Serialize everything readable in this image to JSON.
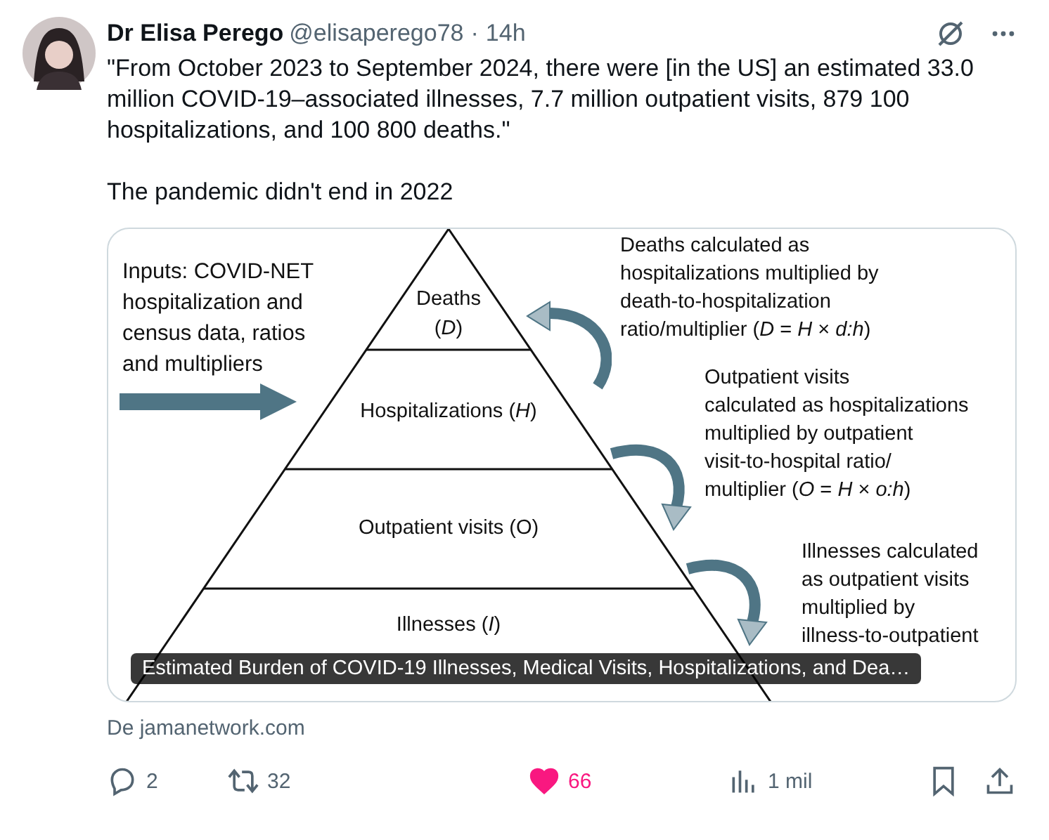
{
  "post": {
    "author": "Dr Elisa Perego",
    "handle": "@elisaperego78",
    "separator": "·",
    "time": "14h",
    "text": "\"From October 2023 to September 2024, there were [in the US] an estimated 33.0 million COVID-19–associated illnesses, 7.7 million outpatient visits, 879 100 hospitalizations, and 100 800 deaths.\"",
    "text_2": "The pandemic didn't end in 2022"
  },
  "figure": {
    "inputs": [
      "Inputs: COVID-NET",
      "hospitalization and",
      "census data, ratios",
      "and multipliers"
    ],
    "levels": [
      {
        "lines": [
          "Deaths",
          "(*D*)"
        ]
      },
      {
        "lines": [
          "Hospitalizations (*H*)"
        ]
      },
      {
        "lines": [
          "Outpatient visits (O)"
        ]
      },
      {
        "lines": [
          "Illnesses (*I*)"
        ]
      }
    ],
    "notes": [
      {
        "lines": [
          "Deaths calculated as",
          "hospitalizations multiplied by",
          "death-to-hospitalization",
          "ratio/multiplier (*D* = *H* × *d:h*)"
        ]
      },
      {
        "lines": [
          "Outpatient visits",
          "calculated as hospitalizations",
          "multiplied by outpatient",
          "visit-to-hospital ratio/",
          "multiplier (*O* = *H* × *o:h*)"
        ]
      },
      {
        "lines": [
          "Illnesses calculated",
          "as outpatient visits",
          "multiplied by",
          "illness-to-outpatient"
        ]
      }
    ],
    "caption": "Estimated Burden of COVID-19 Illnesses, Medical Visits, Hospitalizations, and Dea…"
  },
  "source": "De jamanetwork.com",
  "actions": [
    {
      "kind": "reply",
      "count": "2"
    },
    {
      "kind": "repost",
      "count": "32"
    },
    {
      "kind": "like",
      "count": "66",
      "liked": true
    },
    {
      "kind": "views",
      "count": "1 mil"
    },
    {
      "kind": "bookmark"
    },
    {
      "kind": "share"
    }
  ]
}
